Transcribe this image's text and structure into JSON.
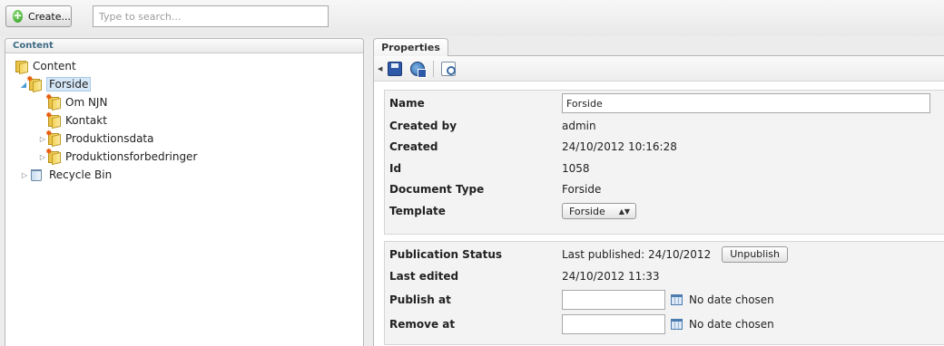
{
  "toolbar": {
    "create_label": "Create...",
    "search_placeholder": "Type to search..."
  },
  "content_tree": {
    "header": "Content",
    "nodes": [
      {
        "label": "Content",
        "icon": "folder-icon",
        "depth": 0
      },
      {
        "label": "Forside",
        "icon": "folder-new-icon",
        "depth": 1,
        "selected": true,
        "expanded": true
      },
      {
        "label": "Om NJN",
        "icon": "folder-new-icon",
        "depth": 2
      },
      {
        "label": "Kontakt",
        "icon": "folder-new-icon",
        "depth": 2
      },
      {
        "label": "Produktionsdata",
        "icon": "folder-new-icon",
        "depth": 2,
        "expandable": true
      },
      {
        "label": "Produktionsforbedringer",
        "icon": "folder-new-icon",
        "depth": 2,
        "expandable": true
      },
      {
        "label": "Recycle Bin",
        "icon": "recycle-bin-icon",
        "depth": 1,
        "expandable": true
      }
    ]
  },
  "properties": {
    "tab_label": "Properties",
    "toolbar_icons": [
      "save-icon",
      "save-and-publish-icon",
      "preview-icon"
    ],
    "info": {
      "name_label": "Name",
      "name_value": "Forside",
      "created_by_label": "Created by",
      "created_by_value": "admin",
      "created_label": "Created",
      "created_value": "24/10/2012 10:16:28",
      "id_label": "Id",
      "id_value": "1058",
      "doctype_label": "Document Type",
      "doctype_value": "Forside",
      "template_label": "Template",
      "template_value": "Forside"
    },
    "publishing": {
      "status_label": "Publication Status",
      "status_value": "Last published: 24/10/2012",
      "unpublish_label": "Unpublish",
      "last_edited_label": "Last edited",
      "last_edited_value": "24/10/2012 11:33",
      "publish_at_label": "Publish at",
      "publish_at_value": "No date chosen",
      "remove_at_label": "Remove at",
      "remove_at_value": "No date chosen"
    }
  }
}
